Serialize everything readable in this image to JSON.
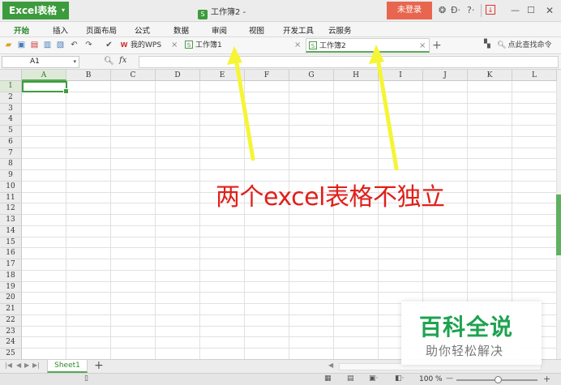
{
  "app": {
    "name": "Excel表格",
    "doc_title": "工作簿2 -",
    "login_label": "未登录"
  },
  "ribbon": {
    "tabs": [
      "开始",
      "插入",
      "页面布局",
      "公式",
      "数据",
      "审阅",
      "视图",
      "开发工具",
      "云服务"
    ]
  },
  "doc_tabs": [
    {
      "label": "我的WPS",
      "active": false
    },
    {
      "label": "工作簿1",
      "active": false
    },
    {
      "label": "工作簿2",
      "active": true
    }
  ],
  "toolbar": {
    "find_label": "点此查找命令"
  },
  "formula_bar": {
    "name_box": "A1",
    "fx_label": "fx",
    "formula_value": ""
  },
  "grid": {
    "columns": [
      "A",
      "B",
      "C",
      "D",
      "E",
      "F",
      "G",
      "H",
      "I",
      "J",
      "K",
      "L"
    ],
    "rows": [
      "1",
      "2",
      "3",
      "4",
      "5",
      "6",
      "7",
      "8",
      "9",
      "10",
      "11",
      "12",
      "13",
      "14",
      "15",
      "16",
      "17",
      "18",
      "19",
      "20",
      "21",
      "22",
      "23",
      "24",
      "25"
    ],
    "selected_cell": "A1"
  },
  "annotation": {
    "text": "两个excel表格不独立",
    "color": "#e0201b",
    "arrow_color": "#f5f536"
  },
  "sheets": {
    "tabs": [
      "Sheet1"
    ],
    "add_label": "+"
  },
  "status": {
    "zoom_label": "100 %",
    "zoom_minus": "—",
    "zoom_plus": "+"
  },
  "watermark": {
    "title": "百科全说",
    "subtitle": "助你轻松解决"
  },
  "colors": {
    "accent_green": "#3c9b3c",
    "login_red": "#e8664f"
  }
}
